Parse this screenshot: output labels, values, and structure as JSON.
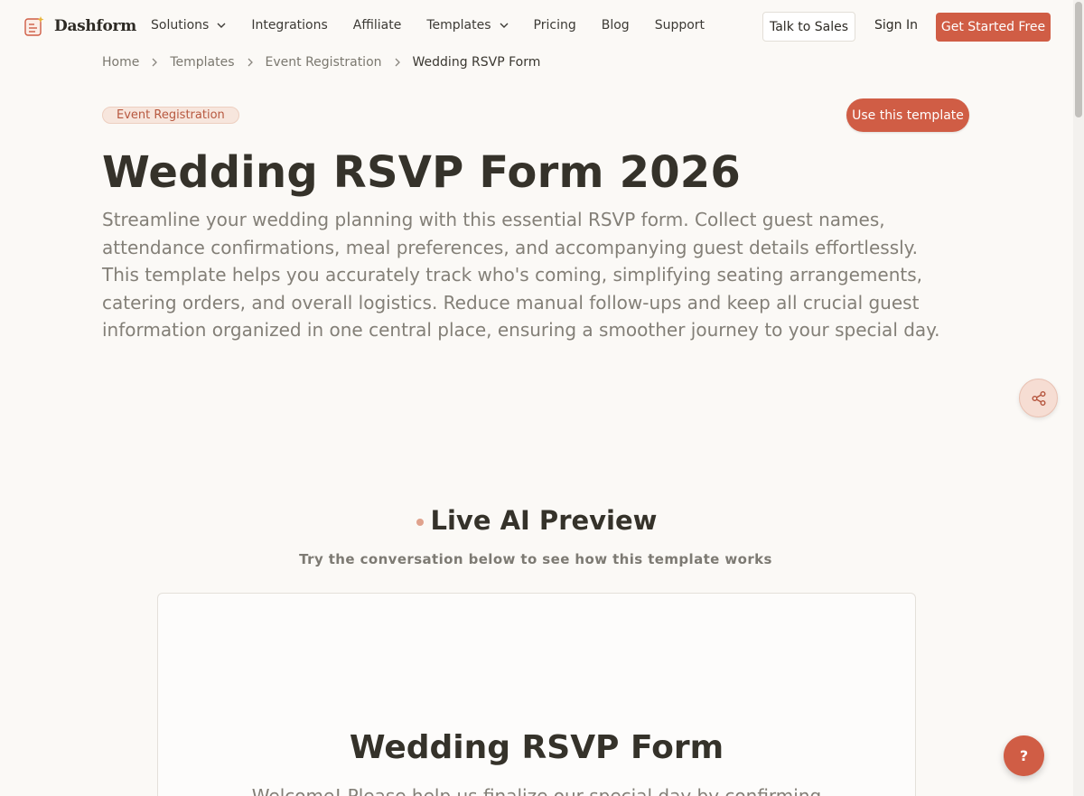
{
  "brand": {
    "name": "Dashform",
    "accent": "#d05d45",
    "logo_icon": "form-sparkle-icon"
  },
  "nav": {
    "items": [
      {
        "label": "Solutions",
        "dropdown": true
      },
      {
        "label": "Integrations",
        "dropdown": false
      },
      {
        "label": "Affiliate",
        "dropdown": false
      },
      {
        "label": "Templates",
        "dropdown": true
      },
      {
        "label": "Pricing",
        "dropdown": false
      },
      {
        "label": "Blog",
        "dropdown": false
      },
      {
        "label": "Support",
        "dropdown": false
      }
    ],
    "talk_to_sales": "Talk to Sales",
    "sign_in": "Sign In",
    "get_started": "Get Started Free"
  },
  "breadcrumb": [
    "Home",
    "Templates",
    "Event Registration",
    "Wedding RSVP Form"
  ],
  "template": {
    "category": "Event Registration",
    "use_button": "Use this template",
    "title": "Wedding RSVP Form 2026",
    "description": "Streamline your wedding planning with this essential RSVP form. Collect guest names, attendance confirmations, meal preferences, and accompanying guest details effortlessly. This template helps you accurately track who's coming, simplifying seating arrangements, catering orders, and overall logistics. Reduce manual follow-ups and keep all crucial guest information organized in one central place, ensuring a smoother journey to your special day."
  },
  "preview": {
    "title": "Live AI Preview",
    "subtitle": "Try the conversation below to see how this template works",
    "form_title": "Wedding RSVP Form",
    "form_intro": "Welcome! Please help us finalize our special day by confirming"
  },
  "floating": {
    "share_icon": "share-icon",
    "help_label": "?"
  }
}
